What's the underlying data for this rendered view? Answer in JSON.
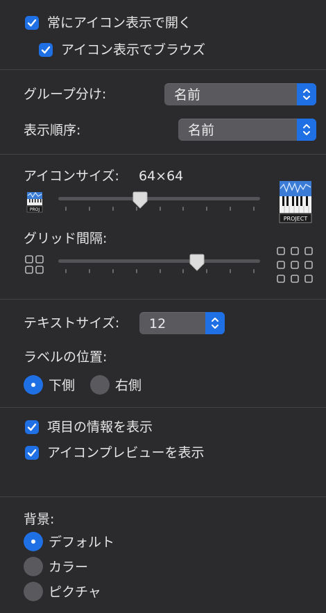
{
  "options": {
    "always_icon_view": {
      "label": "常にアイコン表示で開く",
      "checked": true
    },
    "browse_icon_view": {
      "label": "アイコン表示でブラウズ",
      "checked": true
    }
  },
  "group_by": {
    "label": "グループ分け:",
    "value": "名前"
  },
  "sort_by": {
    "label": "表示順序:",
    "value": "名前"
  },
  "icon_size": {
    "label": "アイコンサイズ:",
    "value_text": "64×64",
    "value": 64,
    "min": 16,
    "max": 512,
    "small_icon_text": "PROJ",
    "large_icon_text": "PROJECT"
  },
  "grid_spacing": {
    "label": "グリッド間隔:",
    "level": 0.7
  },
  "text_size": {
    "label": "テキストサイズ:",
    "value": "12"
  },
  "label_position": {
    "label": "ラベルの位置:",
    "options": [
      {
        "label": "下側",
        "selected": true
      },
      {
        "label": "右側",
        "selected": false
      }
    ]
  },
  "info": {
    "show_item_info": {
      "label": "項目の情報を表示",
      "checked": true
    },
    "show_icon_preview": {
      "label": "アイコンプレビューを表示",
      "checked": true
    }
  },
  "background": {
    "label": "背景:",
    "options": [
      {
        "label": "デフォルト",
        "selected": true
      },
      {
        "label": "カラー",
        "selected": false
      },
      {
        "label": "ピクチャ",
        "selected": false
      }
    ]
  },
  "colors": {
    "accent": "#1f6fe5",
    "panel": "#2b2b2d",
    "control": "#5a5a5e"
  }
}
